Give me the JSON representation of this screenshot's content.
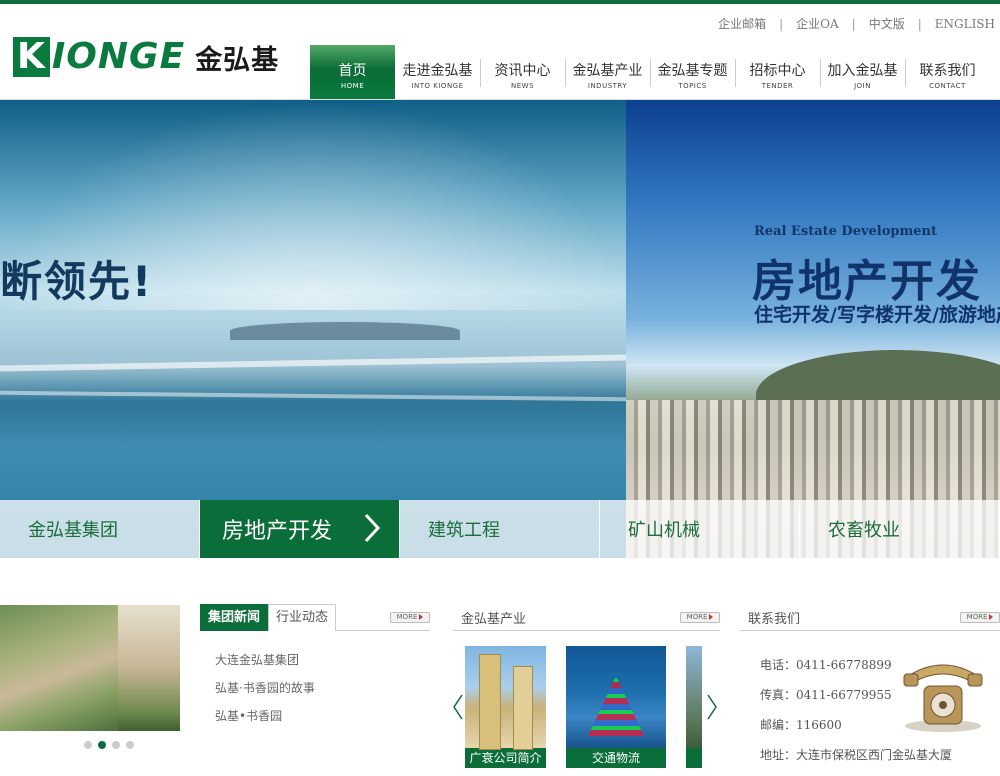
{
  "utility": [
    "企业邮箱",
    "企业OA",
    "中文版",
    "ENGLISH"
  ],
  "logo": {
    "en": "IONGE",
    "en_k": "K",
    "cn": "金弘基"
  },
  "nav": [
    {
      "cn": "首页",
      "en": "HOME"
    },
    {
      "cn": "走进金弘基",
      "en": "INTO KIONGE"
    },
    {
      "cn": "资讯中心",
      "en": "NEWS"
    },
    {
      "cn": "金弘基产业",
      "en": "INDUSTRY"
    },
    {
      "cn": "金弘基专题",
      "en": "TOPICS"
    },
    {
      "cn": "招标中心",
      "en": "TENDER"
    },
    {
      "cn": "加入金弘基",
      "en": "JOIN"
    },
    {
      "cn": "联系我们",
      "en": "CONTACT"
    }
  ],
  "hero": {
    "slogan": "断领先!",
    "en_title": "Real Estate Development",
    "cn_title": "房地产开发",
    "sub": "住宅开发/写字楼开发/旅游地产"
  },
  "tabs": [
    "金弘基集团",
    "房地产开发",
    "建筑工程",
    "矿山机械",
    "农畜牧业"
  ],
  "news": {
    "tab1": "集团新闻",
    "tab2": "行业动态",
    "items": [
      "大连金弘基集团",
      "弘基·书香园的故事",
      "弘基•书香园"
    ]
  },
  "industry": {
    "title": "金弘基产业",
    "cards": [
      "广衰公司简介",
      "交通物流"
    ]
  },
  "contact": {
    "title": "联系我们",
    "phone": "电话：0411-66778899",
    "fax": "传真：0411-66779955",
    "zip": "邮编：116600",
    "address": "地址：大连市保税区西门金弘基大厦"
  },
  "more_label": "MORE",
  "colors": {
    "brand_green": "#0b6e3a"
  }
}
